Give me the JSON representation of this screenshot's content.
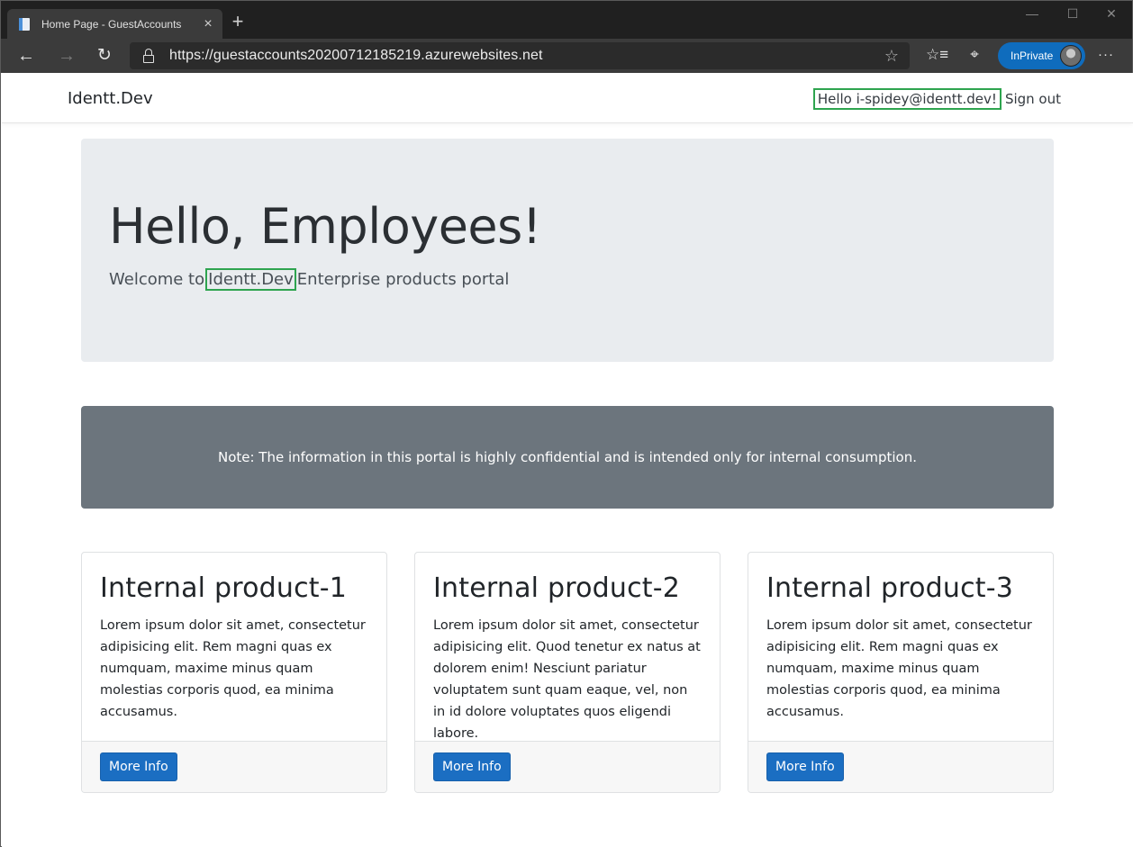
{
  "browser": {
    "tab": {
      "title": "Home Page - GuestAccounts",
      "close_icon": "close-icon",
      "favicon": "page-icon"
    },
    "new_tab_symbol": "+",
    "window_controls": {
      "minimize": "—",
      "maximize": "☐",
      "close": "✕"
    },
    "nav": {
      "back": "←",
      "forward": "→",
      "refresh": "↻"
    },
    "address": {
      "url": "https://guestaccounts20200712185219.azurewebsites.net"
    },
    "toolbar_icons": {
      "favorite": "☆",
      "favorites": "☆≡",
      "collections": "⌖"
    },
    "inprivate_label": "InPrivate",
    "more_label": "···"
  },
  "site": {
    "brand": "Identt.Dev",
    "greeting": "Hello i-spidey@identt.dev!",
    "sign_out": "Sign out"
  },
  "hero": {
    "title": "Hello, Employees!",
    "lead_prefix": "Welcome to",
    "lead_brand": "Identt.Dev",
    "lead_suffix": "Enterprise products portal"
  },
  "note": {
    "text": "Note: The information in this portal is highly confidential and is intended only for internal consumption."
  },
  "colors": {
    "accent_button": "#1b6ec2",
    "note_bg": "#6c757d",
    "hero_bg": "#e9ecef",
    "highlight_border": "#2ea44f",
    "inprivate": "#0f6cbd"
  },
  "cards": [
    {
      "title": "Internal product-1",
      "text": "Lorem ipsum dolor sit amet, consectetur adipisicing elit. Rem magni quas ex numquam, maxime minus quam molestias corporis quod, ea minima accusamus.",
      "button": "More Info"
    },
    {
      "title": "Internal product-2",
      "text": "Lorem ipsum dolor sit amet, consectetur adipisicing elit. Quod tenetur ex natus at dolorem enim! Nesciunt pariatur voluptatem sunt quam eaque, vel, non in id dolore voluptates quos eligendi labore.",
      "button": "More Info"
    },
    {
      "title": "Internal product-3",
      "text": "Lorem ipsum dolor sit amet, consectetur adipisicing elit. Rem magni quas ex numquam, maxime minus quam molestias corporis quod, ea minima accusamus.",
      "button": "More Info"
    }
  ]
}
